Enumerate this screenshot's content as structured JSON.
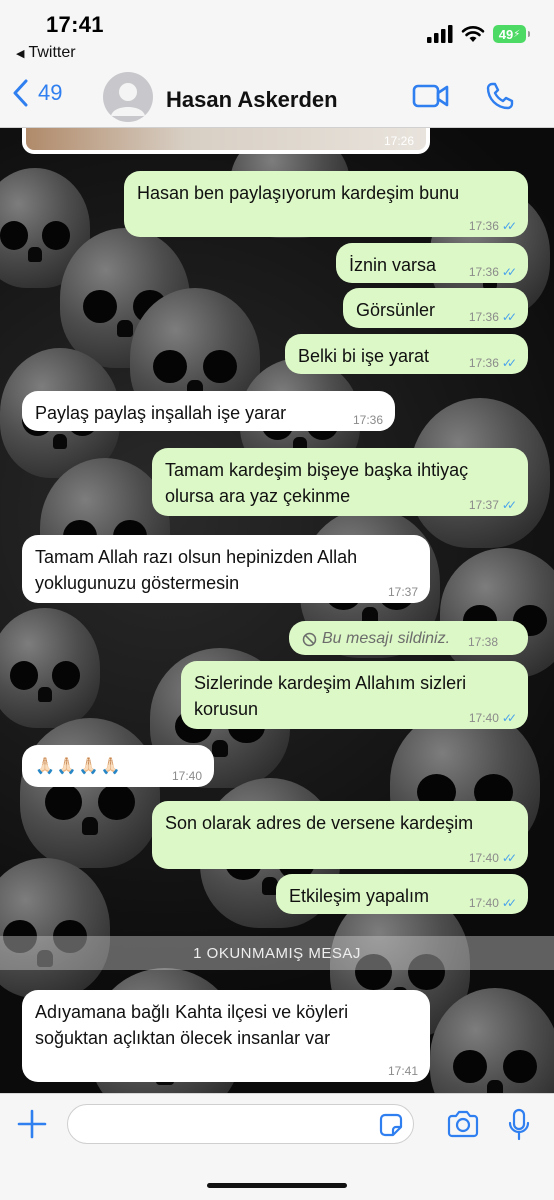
{
  "status_bar": {
    "time": "17:41",
    "back_app": "Twitter",
    "battery": "49"
  },
  "header": {
    "back_count": "49",
    "contact_name": "Hasan Askerden"
  },
  "chat": {
    "previous_image_time": "17:26",
    "unread_label": "1 OKUNMAMIŞ MESAJ",
    "messages": [
      {
        "text": "Hasan ben paylaşıyorum kardeşim bunu",
        "time": "17:36",
        "dir": "out"
      },
      {
        "text": "İznin varsa",
        "time": "17:36",
        "dir": "out"
      },
      {
        "text": "Görsünler",
        "time": "17:36",
        "dir": "out"
      },
      {
        "text": "Belki bi işe yarat",
        "time": "17:36",
        "dir": "out"
      },
      {
        "text": "Paylaş paylaş inşallah işe yarar",
        "time": "17:36",
        "dir": "in"
      },
      {
        "text": "Tamam kardeşim bişeye başka ihtiyaç olursa ara yaz çekinme",
        "time": "17:37",
        "dir": "out"
      },
      {
        "text": "Tamam Allah razı olsun hepinizden Allah yoklugunuzu göstermesin",
        "time": "17:37",
        "dir": "in"
      },
      {
        "text": "Bu mesajı sildiniz.",
        "time": "17:38",
        "dir": "out",
        "deleted": true
      },
      {
        "text": "Sizlerinde kardeşim Allahım sizleri korusun",
        "time": "17:40",
        "dir": "out"
      },
      {
        "text": "🙏🏻🙏🏻🙏🏻🙏🏻",
        "time": "17:40",
        "dir": "in"
      },
      {
        "text": "Son olarak adres de versene kardeşim",
        "time": "17:40",
        "dir": "out"
      },
      {
        "text": "Etkileşim yapalım",
        "time": "17:40",
        "dir": "out"
      },
      {
        "text": "Adıyamana bağlı Kahta ilçesi ve köyleri soğuktan açlıktan ölecek insanlar var",
        "time": "17:41",
        "dir": "in"
      }
    ]
  },
  "icons": {
    "back": "chevron-left-icon",
    "video": "video-camera-icon",
    "call": "phone-icon",
    "plus": "plus-icon",
    "sticker": "sticker-icon",
    "camera": "camera-icon",
    "mic": "microphone-icon",
    "blocked": "deleted-message-icon"
  },
  "colors": {
    "accent": "#2f7ff0",
    "outgoing": "#dcf8c6",
    "incoming": "#ffffff",
    "ticks": "#4aa3ec",
    "battery": "#4cd964"
  }
}
